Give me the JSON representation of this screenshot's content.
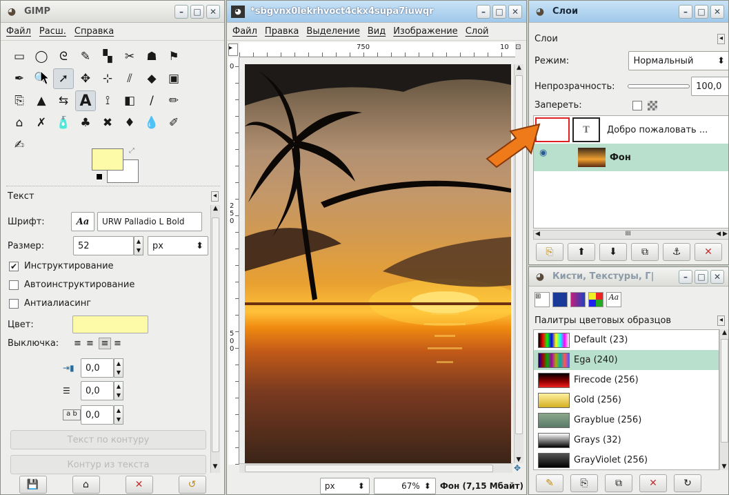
{
  "toolbox": {
    "title": "GIMP",
    "menu": [
      "Файл",
      "Расш.",
      "Справка"
    ],
    "tools": [
      "▭",
      "◯",
      "ᘓ",
      "✎",
      "▚",
      "✂",
      "☗",
      "⚑",
      "✒",
      "🔍",
      "➚",
      "✥",
      "⊹",
      "⫽",
      "◆",
      "▣",
      "⎘",
      "▲",
      "⇆",
      "A",
      "⟟",
      "◧",
      "/",
      "✏",
      "⌂",
      "✗",
      "🧴",
      "♣",
      "✖",
      "♦",
      "💧",
      "✐",
      "✍"
    ],
    "fg_color": "#fefba8",
    "bg_color": "#ffffff",
    "text_panel": {
      "header": "Текст",
      "font_label": "Шрифт:",
      "font_icon": "Aa",
      "font_value": "URW Palladio L Bold",
      "size_label": "Размер:",
      "size_value": "52",
      "size_unit": "px",
      "hinting": "Инструктирование",
      "autohint": "Автоинструктирование",
      "antialias": "Антиалиасинг",
      "color_label": "Цвет:",
      "justify_label": "Выключка:",
      "indent": "0,0",
      "line_spacing": "0,0",
      "letter_spacing": "0,0",
      "text_along_path": "Текст по контуру",
      "path_from_text": "Контур из текста"
    }
  },
  "image_window": {
    "title": "*sbgvnx0lekrhvoct4ckx4supa7iuwqr",
    "menu": [
      "Файл",
      "Правка",
      "Выделение",
      "Вид",
      "Изображение",
      "Слой"
    ],
    "ruler_top_mark": "750",
    "ruler_top_mark2": "10",
    "ruler_left_0": "0",
    "ruler_left_250": "2\n5\n0",
    "ruler_left_500": "5\n0\n0",
    "unit": "px",
    "zoom": "67%",
    "status": "Фон (7,15 Мбайт)"
  },
  "layers": {
    "title": "Слои",
    "tab_label": "Слои",
    "mode_label": "Режим:",
    "mode_value": "Нормальный",
    "opacity_label": "Непрозрачность:",
    "opacity_value": "100,0",
    "lock_label": "Запереть:",
    "items": [
      {
        "name": "Добро пожаловать ..."
      },
      {
        "name": "Фон"
      }
    ]
  },
  "brushes": {
    "title": "Кисти, Текстуры, Г|",
    "tab_label": "Палитры цветовых образцов",
    "palettes": [
      {
        "name": "Default (23)"
      },
      {
        "name": "Ega (240)"
      },
      {
        "name": "Firecode (256)"
      },
      {
        "name": "Gold (256)"
      },
      {
        "name": "Grayblue (256)"
      },
      {
        "name": "Grays (32)"
      },
      {
        "name": "GrayViolet (256)"
      }
    ]
  },
  "colors": {
    "accent_arrow": "#ef7a1a",
    "selected_row": "#b8e0cc",
    "red_frame": "#e02020"
  }
}
